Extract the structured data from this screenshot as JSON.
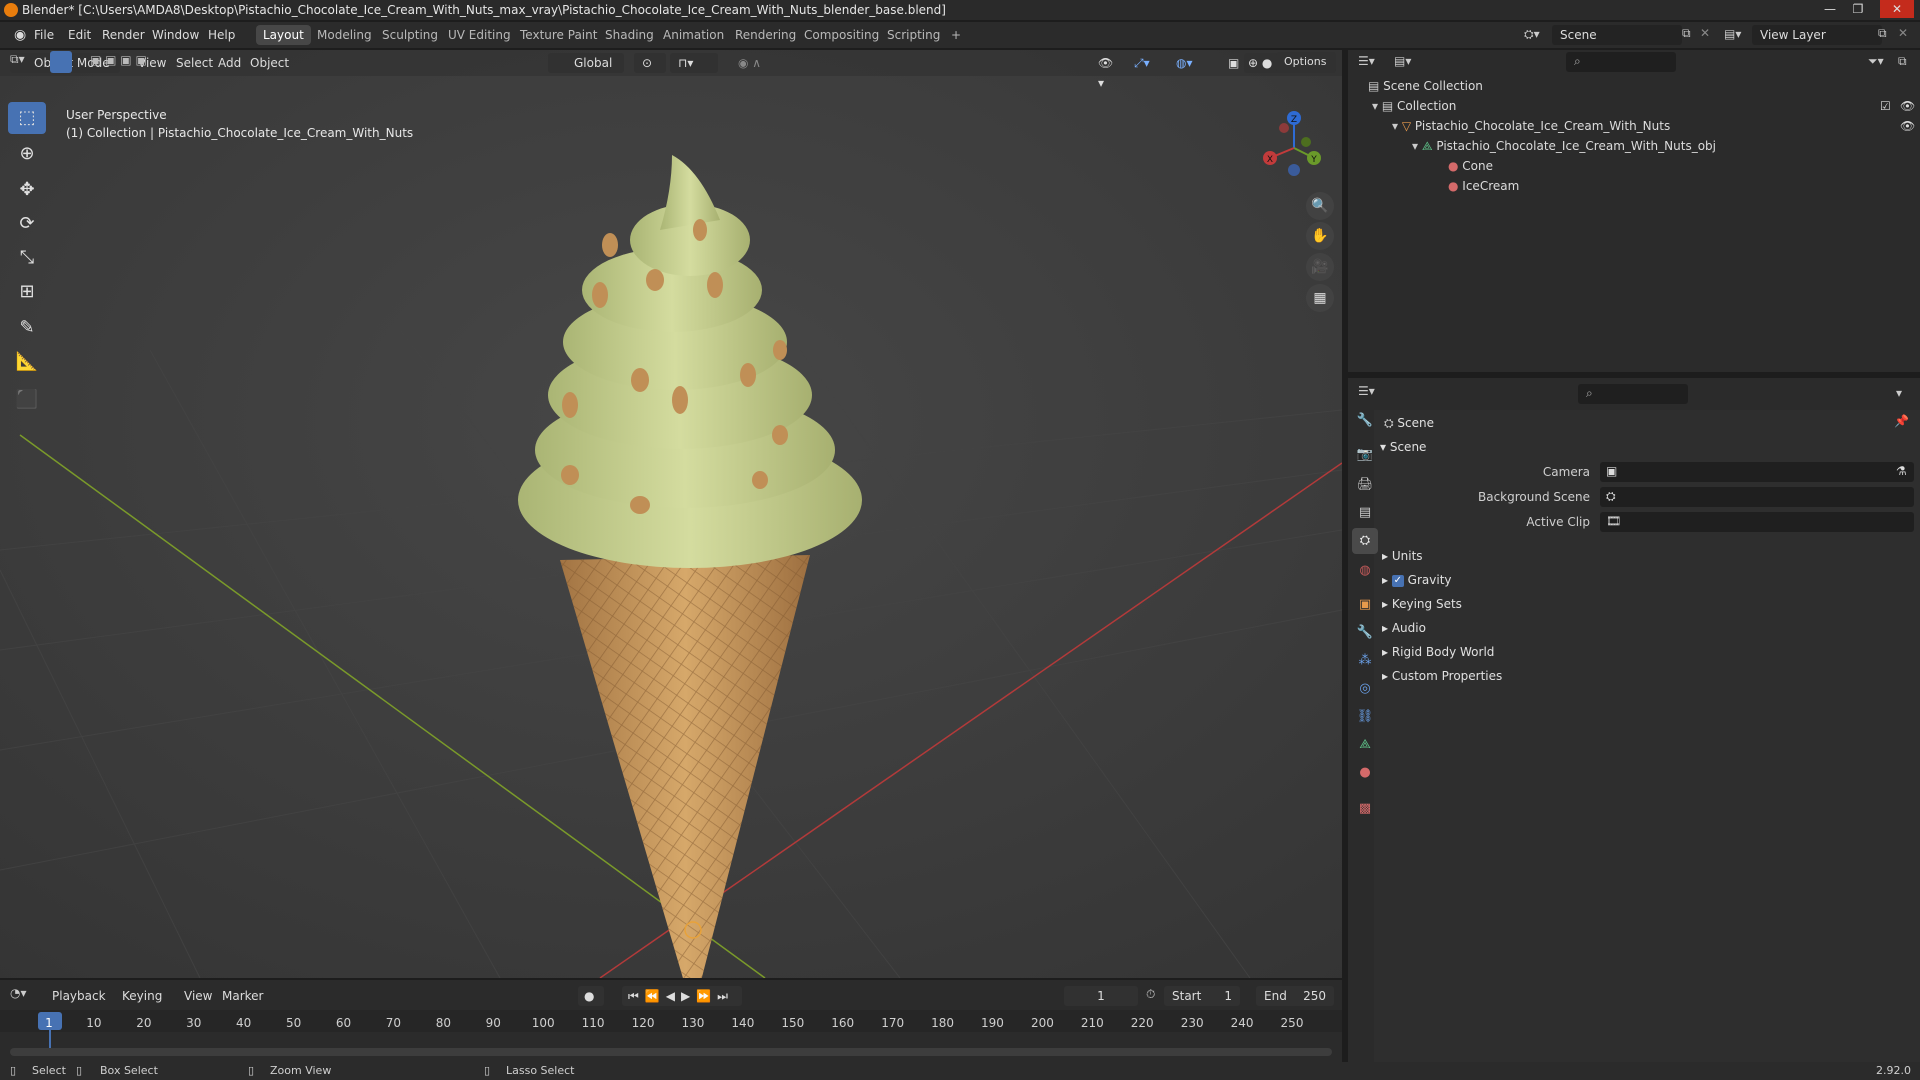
{
  "app": {
    "title": "Blender* [C:\\Users\\AMDA8\\Desktop\\Pistachio_Chocolate_Ice_Cream_With_Nuts_max_vray\\Pistachio_Chocolate_Ice_Cream_With_Nuts_blender_base.blend]"
  },
  "menu": {
    "items": [
      "File",
      "Edit",
      "Render",
      "Window",
      "Help"
    ]
  },
  "workspaces": {
    "tabs": [
      "Layout",
      "Modeling",
      "Sculpting",
      "UV Editing",
      "Texture Paint",
      "Shading",
      "Animation",
      "Rendering",
      "Compositing",
      "Scripting"
    ],
    "active": "Layout",
    "add": "+"
  },
  "top_right": {
    "scene": "Scene",
    "view_layer": "View Layer"
  },
  "viewport_header": {
    "mode": "Object Mode",
    "menus": [
      "View",
      "Select",
      "Add",
      "Object"
    ],
    "transform_orientation": "Global",
    "options": "Options"
  },
  "viewport": {
    "perspective": "User Perspective",
    "collection_info": "(1) Collection | Pistachio_Chocolate_Ice_Cream_With_Nuts",
    "axes": {
      "x": "X",
      "y": "Y",
      "z": "Z"
    }
  },
  "outliner": {
    "scene_collection": "Scene Collection",
    "collection": "Collection",
    "object": "Pistachio_Chocolate_Ice_Cream_With_Nuts",
    "mesh": "Pistachio_Chocolate_Ice_Cream_With_Nuts_obj",
    "materials": [
      "Cone",
      "IceCream"
    ]
  },
  "properties": {
    "context": "Scene",
    "panel_title": "Scene",
    "fields": [
      {
        "label": "Camera"
      },
      {
        "label": "Background Scene"
      },
      {
        "label": "Active Clip"
      }
    ],
    "subpanels": [
      "Units",
      "Gravity",
      "Keying Sets",
      "Audio",
      "Rigid Body World",
      "Custom Properties"
    ],
    "gravity_checked": true
  },
  "timeline": {
    "menus": [
      "Playback",
      "Keying",
      "View",
      "Marker"
    ],
    "current_frame": "1",
    "start_label": "Start",
    "start": "1",
    "end_label": "End",
    "end": "250",
    "ruler": [
      "1",
      "10",
      "20",
      "30",
      "40",
      "50",
      "60",
      "70",
      "80",
      "90",
      "100",
      "110",
      "120",
      "130",
      "140",
      "150",
      "160",
      "170",
      "180",
      "190",
      "200",
      "210",
      "220",
      "230",
      "240",
      "250"
    ]
  },
  "status": {
    "select": "Select",
    "box_select": "Box Select",
    "zoom_view": "Zoom View",
    "lasso_select": "Lasso Select",
    "version": "2.92.0"
  },
  "colors": {
    "accent": "#4772b3",
    "x_axis": "#c23b3b",
    "y_axis": "#6a9a2a",
    "z_axis": "#2e6bd4",
    "ice_cream": "#c7d08f",
    "cone": "#c89a5c"
  }
}
